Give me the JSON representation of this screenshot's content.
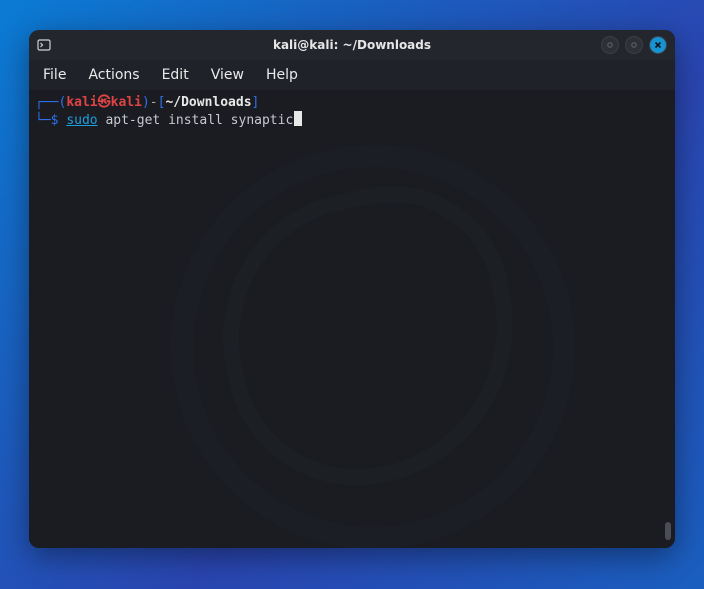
{
  "window": {
    "title": "kali@kali: ~/Downloads"
  },
  "menubar": {
    "items": [
      {
        "label": "File"
      },
      {
        "label": "Actions"
      },
      {
        "label": "Edit"
      },
      {
        "label": "View"
      },
      {
        "label": "Help"
      }
    ]
  },
  "prompt": {
    "corner_top": "┌──",
    "open_paren": "(",
    "user": "kali",
    "at": "㉿",
    "host": "kali",
    "close_paren": ")",
    "sep_dash": "-",
    "open_br": "[",
    "cwd": "~/Downloads",
    "close_br": "]",
    "corner_bot": "└─",
    "symbol": "$"
  },
  "command": {
    "sudo": "sudo",
    "rest": " apt-get install synaptic"
  }
}
